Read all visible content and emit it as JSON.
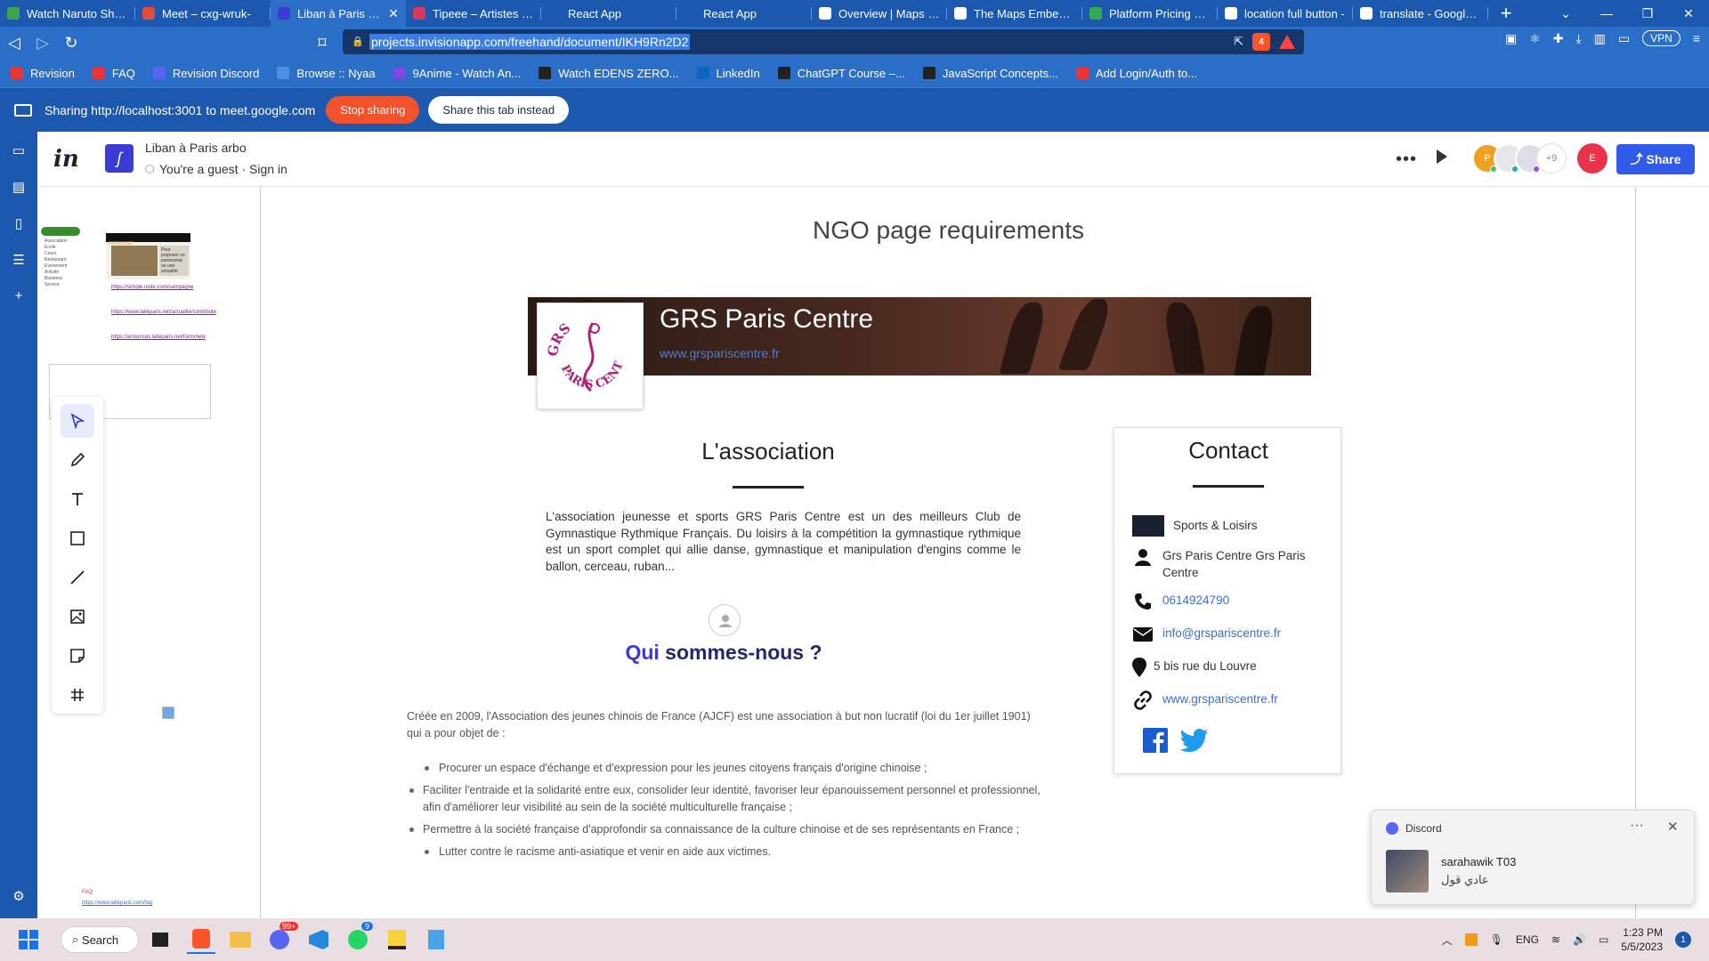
{
  "browser": {
    "tabs": [
      {
        "label": "Watch Naruto Shippu",
        "color": "#3aa54a"
      },
      {
        "label": "Meet – cxg-wruk-",
        "color": "#e64a3b"
      },
      {
        "label": "Liban à Paris arbo",
        "color": "#3b3bd6",
        "active": true
      },
      {
        "label": "Tipeee – Artistes & C",
        "color": "#d6395b"
      },
      {
        "label": "React App",
        "color": "#1b58ae"
      },
      {
        "label": "React App",
        "color": "#1b58ae"
      },
      {
        "label": "Overview | Maps Sta",
        "color": "#fff"
      },
      {
        "label": "The Maps Embed API",
        "color": "#fff"
      },
      {
        "label": "Platform Pricing & AP",
        "color": "#34a853"
      },
      {
        "label": "location full button -",
        "color": "#fff"
      },
      {
        "label": "translate - Google Se",
        "color": "#fff"
      }
    ],
    "url": "projects.invisionapp.com/freehand/document/IKH9Rn2D2",
    "brave_count": "4",
    "vpn_label": "VPN",
    "bookmarks": [
      {
        "label": "Revision",
        "color": "#e33"
      },
      {
        "label": "FAQ",
        "color": "#e33"
      },
      {
        "label": "Revision Discord",
        "color": "#5865f2"
      },
      {
        "label": "Browse :: Nyaa",
        "color": "#4a90e2"
      },
      {
        "label": "9Anime - Watch An...",
        "color": "#7a4ae2"
      },
      {
        "label": "Watch EDENS ZERO...",
        "color": "#222"
      },
      {
        "label": "LinkedIn",
        "color": "#0a66c2"
      },
      {
        "label": "ChatGPT Course –...",
        "color": "#222"
      },
      {
        "label": "JavaScript Concepts...",
        "color": "#222"
      },
      {
        "label": "Add Login/Auth to...",
        "color": "#e33"
      }
    ],
    "sharing": {
      "text": "Sharing http://localhost:3001 to meet.google.com",
      "stop": "Stop sharing",
      "share_tab": "Share this tab instead"
    }
  },
  "app": {
    "doc_title": "Liban à Paris arbo",
    "guest_text": "You're a guest · Sign in",
    "avatar_more": "+9",
    "avatar_p": "P",
    "avatar_e": "E",
    "share_label": "Share"
  },
  "board": {
    "req_title": "NGO page requirements",
    "hero_title": "GRS Paris Centre",
    "hero_url": "www.grspariscentre.fr",
    "logo_text_top": "GRS",
    "logo_text_bottom": "PARIS CENTRE",
    "assoc_title": "L'association",
    "assoc_text": "L'association jeunesse et sports GRS Paris Centre est un des meilleurs Club de Gymnastique Rythmique Français. Du loisirs à la compétition la gymnastique rythmique est un sport complet qui allie danse, gymnastique et manipulation d'engins comme le ballon, cerceau, ruban...",
    "qui_hl": "Qui",
    "qui_rest": "sommes-nous ?",
    "cree_text": "Créée en 2009, l'Association des jeunes chinois de France (AJCF) est une association à but non lucratif (loi du 1er juillet 1901) qui a pour objet de :",
    "bullets": [
      "Procurer un espace d'échange et d'expression pour les jeunes citoyens français d'origine chinoise ;",
      "Faciliter l'entraide et la solidarité entre eux, consolider leur identité, favoriser leur épanouissement personnel et professionnel, afin d'améliorer leur visibilité au sein de la société multiculturelle française ;",
      "Permettre à la société française d'approfondir sa connaissance de la culture chinoise et de ses représentants en France ;",
      "Lutter contre le racisme anti-asiatique et venir en aide aux victimes."
    ],
    "contact": {
      "title": "Contact",
      "category": "Sports & Loisirs",
      "name": "Grs Paris Centre Grs Paris Centre",
      "phone": "0614924790",
      "email": "info@grspariscentre.fr",
      "address": "5 bis rue du Louvre",
      "website": "www.grspariscentre.fr"
    },
    "mini": {
      "list": [
        "Association",
        "Ecole",
        "Cours",
        "Restaurant",
        "Evenement",
        "Activité",
        "Business",
        "Service"
      ],
      "card_head": "PROPOSEZ",
      "card_side": "Pour proposer un partenariat ou une actualité",
      "links": [
        "https://simple.ulule.com/campagne",
        "https://www.lalleparis.net/actualite/contribute",
        "https://annonces.lalleparis.net/form/new"
      ],
      "faq_title": "FAQ",
      "faq_link": "https://www.lalleparis.com/faq"
    }
  },
  "discord": {
    "app": "Discord",
    "user": "sarahawik T03",
    "message": "عادي قول"
  },
  "taskbar": {
    "search": "Search",
    "lang": "ENG",
    "time": "1:23 PM",
    "date": "5/5/2023",
    "notif": "1",
    "discord_badge": "99+",
    "whatsapp_badge": "9"
  }
}
